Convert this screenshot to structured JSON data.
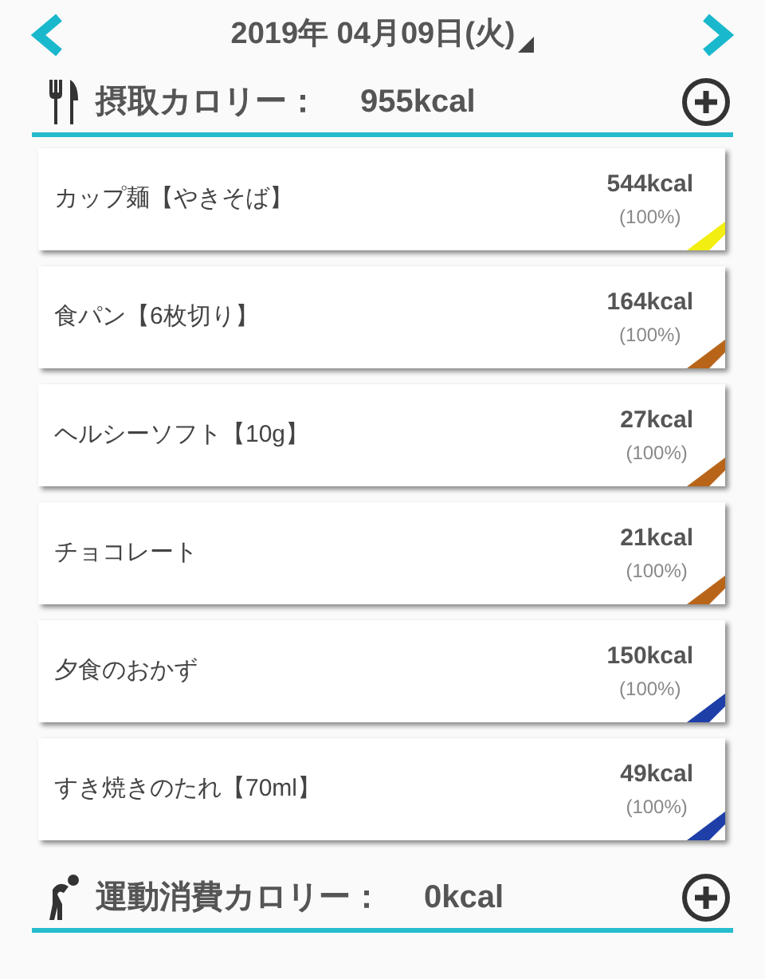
{
  "date": "2019年 04月09日(火)",
  "intake": {
    "label": "摂取カロリー：",
    "value": "955kcal"
  },
  "foods": [
    {
      "name": "カップ麺【やきそば】",
      "kcal": "544kcal",
      "percent": "(100%)",
      "color": "#f2ee10"
    },
    {
      "name": "食パン【6枚切り】",
      "kcal": "164kcal",
      "percent": "(100%)",
      "color": "#b8651a"
    },
    {
      "name": "ヘルシーソフト【10g】",
      "kcal": "27kcal",
      "percent": "(100%)",
      "color": "#b8651a"
    },
    {
      "name": "チョコレート",
      "kcal": "21kcal",
      "percent": "(100%)",
      "color": "#b8651a"
    },
    {
      "name": "夕食のおかず",
      "kcal": "150kcal",
      "percent": "(100%)",
      "color": "#1e3fa8"
    },
    {
      "name": "すき焼きのたれ【70ml】",
      "kcal": "49kcal",
      "percent": "(100%)",
      "color": "#1e3fa8"
    }
  ],
  "exercise": {
    "label": "運動消費カロリー：",
    "value": "0kcal"
  }
}
